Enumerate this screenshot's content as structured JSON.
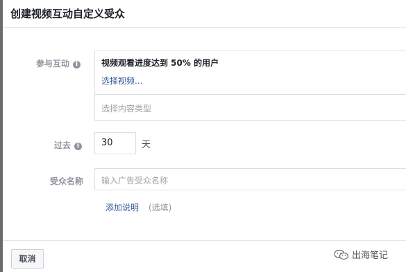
{
  "dialog": {
    "title": "创建视频互动自定义受众",
    "engagement": {
      "label": "参与互动",
      "info_icon": "info-icon",
      "selected_title": "视频观看进度达到 50% 的用户",
      "select_video_link": "选择视频...",
      "content_type_placeholder": "选择内容类型"
    },
    "period": {
      "label": "过去",
      "info_icon": "info-icon",
      "days_value": "30",
      "unit": "天"
    },
    "audience_name": {
      "label": "受众名称",
      "placeholder": "输入广告受众名称"
    },
    "add_description": {
      "link": "添加说明",
      "optional": "(选填)"
    },
    "footer": {
      "cancel_label": "取消"
    }
  },
  "watermark": {
    "text": "出海笔记",
    "icon": "wechat-icon"
  }
}
